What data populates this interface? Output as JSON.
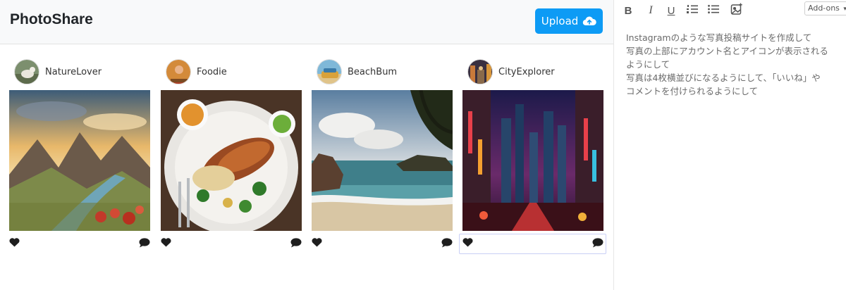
{
  "app": {
    "brand": "PhotoShare",
    "upload_label": "Upload",
    "icons": {
      "upload": "cloud-upload-icon",
      "like": "heart-icon",
      "comment": "comment-icon"
    }
  },
  "posts": [
    {
      "username": "NatureLover",
      "photo": "mountain-river-landscape"
    },
    {
      "username": "Foodie",
      "photo": "roast-chicken-plate"
    },
    {
      "username": "BeachBum",
      "photo": "beach-seascape"
    },
    {
      "username": "CityExplorer",
      "photo": "neon-city-street"
    }
  ],
  "editor": {
    "toolbar": {
      "bold": "B",
      "italic": "I",
      "underline": "U",
      "addons": "Add-ons",
      "icons": [
        "bold-icon",
        "italic-icon",
        "underline-icon",
        "ordered-list-icon",
        "bullet-list-icon",
        "add-image-icon"
      ]
    },
    "lines": [
      "Instagramのような写真投稿サイトを作成して",
      "写真の上部にアカウント名とアイコンが表示される",
      "ようにして",
      "写真は4枚横並びになるようにして、「いいね」や",
      "コメントを付けられるようにして"
    ]
  },
  "colors": {
    "accent": "#0d9bf5",
    "header_bg": "#f8f9fa",
    "text": "#212529"
  }
}
